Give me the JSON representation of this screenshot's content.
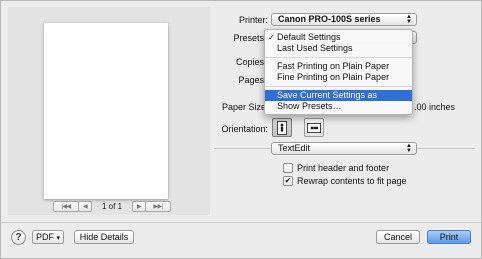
{
  "labels": {
    "printer": "Printer:",
    "presets": "Presets",
    "copies": "Copies",
    "pages": "Pages",
    "paper_size": "Paper Size",
    "paper_size_suffix": ".00 inches",
    "orientation": "Orientation:"
  },
  "printer_value": "Canon PRO-100S series",
  "presets_menu": {
    "items": [
      {
        "label": "Default Settings",
        "checked": true,
        "check_glyph": "✓"
      },
      {
        "label": "Last Used Settings"
      },
      {
        "label": "Fast Printing on Plain Paper"
      },
      {
        "label": "Fine Printing on Plain Paper"
      },
      {
        "label": "Save Current Settings as Preset…",
        "highlighted": true
      },
      {
        "label": "Show Presets…"
      }
    ]
  },
  "app_section_value": "TextEdit",
  "options": {
    "print_header_footer": {
      "label": "Print header and footer",
      "checked": false
    },
    "rewrap": {
      "label": "Rewrap contents to fit page",
      "checked": true,
      "glyph": "✔"
    }
  },
  "preview": {
    "page_indicator": "1 of 1",
    "first_glyph": "|◀◀",
    "prev_glyph": "◀",
    "next_glyph": "▶",
    "last_glyph": "▶▶|"
  },
  "bottom": {
    "help_label": "?",
    "pdf_label": "PDF",
    "pdf_arrow": "▾",
    "hide_details_label": "Hide Details",
    "cancel_label": "Cancel",
    "print_label": "Print"
  },
  "colors": {
    "highlight": "#2f6fd6",
    "primary_button": "#5c9bea"
  },
  "icons": {
    "popup_arrows": "updown-arrows",
    "portrait": "portrait-icon",
    "landscape": "landscape-icon"
  }
}
